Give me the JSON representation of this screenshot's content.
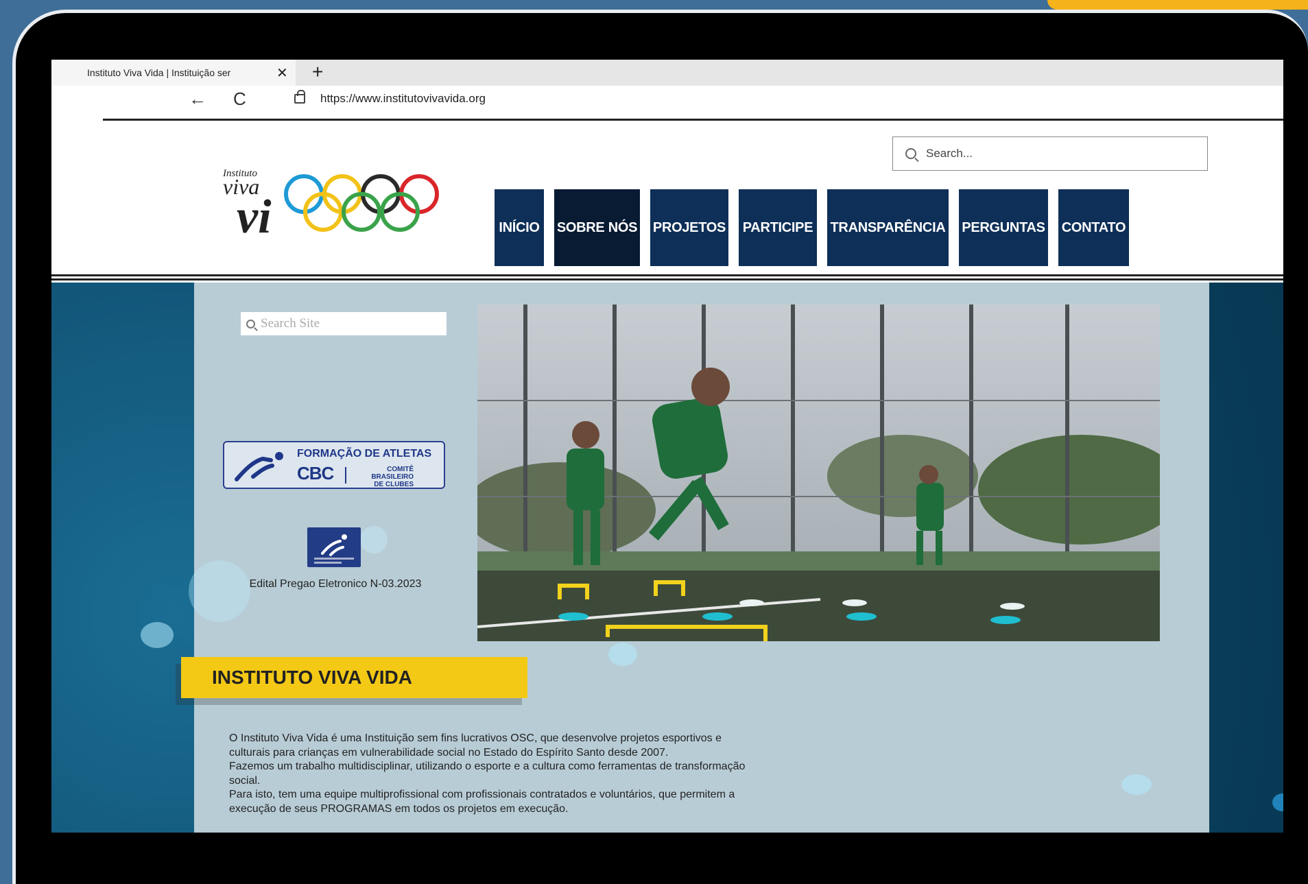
{
  "browser": {
    "tab_title": "Instituto Viva Vida | Instituição ser",
    "tab_close": "✕",
    "new_tab": "+",
    "back_icon": "←",
    "reload_icon": "C",
    "url": "https://www.institutovivavida.org"
  },
  "header": {
    "search_placeholder": "Search...",
    "logo": {
      "word1": "Instituto",
      "word2": "viva",
      "word3": "vi"
    },
    "menu": [
      {
        "label": "INÍCIO"
      },
      {
        "label": "SOBRE NÓS"
      },
      {
        "label": "PROJETOS"
      },
      {
        "label": "PARTICIPE"
      },
      {
        "label": "TRANSPARÊNCIA"
      },
      {
        "label": "PERGUNTAS"
      },
      {
        "label": "CONTATO"
      }
    ]
  },
  "sidebar": {
    "search_placeholder": "Search Site",
    "cbc_badge": {
      "title": "FORMAÇÃO DE ATLETAS",
      "abbr": "CBC",
      "sub1": "COMITÊ BRASILEIRO",
      "sub2": "DE CLUBES"
    },
    "edital_link": "Edital Pregao Eletronico N-03.2023"
  },
  "main": {
    "banner_title": "INSTITUTO VIVA VIDA",
    "about_lines": [
      "O Instituto Viva Vida é uma Instituição sem fins lucrativos OSC, que desenvolve projetos esportivos e",
      "culturais para crianças em vulnerabilidade social no Estado do Espírito Santo desde 2007.",
      "Fazemos um trabalho multidisciplinar, utilizando o esporte e a cultura como ferramentas de transformação",
      "social.",
      "Para isto, tem uma equipe multiprofissional com profissionais contratados e voluntários, que permitem a",
      "execução de seus PROGRAMAS em todos os projetos em execução."
    ]
  },
  "colors": {
    "page_bg": "#3f6e98",
    "accent_orange": "#f6b21a",
    "menu_navy": "#0e2f57",
    "banner_yellow": "#f4c915",
    "panel_gray_blue": "#b8ccd6"
  }
}
